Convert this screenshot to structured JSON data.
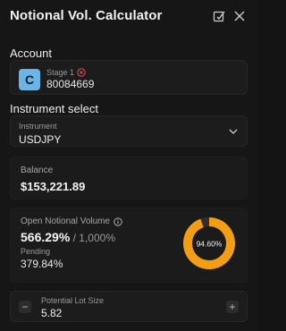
{
  "title": "Notional Vol. Calculator",
  "icons": {
    "edit": "edit-square-icon",
    "close": "close-icon",
    "info": "info-icon",
    "error": "error-x-icon",
    "chevron": "chevron-down-icon"
  },
  "colors": {
    "accent": "#f29d16",
    "avatar": "#6cb4e6",
    "error": "#e0505a",
    "background": "#161616"
  },
  "account": {
    "label": "Account",
    "avatar_letter": "C",
    "stage": "Stage 1",
    "number": "80084669"
  },
  "instrument": {
    "section_label": "Instrument select",
    "field_label": "Instrument",
    "value": "USDJPY"
  },
  "balance": {
    "label": "Balance",
    "value": "$153,221.89"
  },
  "notional": {
    "label": "Open Notional Volume",
    "percent": "566.29%",
    "limit": " / 1,000%",
    "pending_label": "Pending",
    "pending_value": "379.84%",
    "gauge_text": "94.60%",
    "gauge_fraction": 0.946
  },
  "lot": {
    "label": "Potential Lot Size",
    "value": "5.82",
    "minus": "−",
    "plus": "+"
  }
}
